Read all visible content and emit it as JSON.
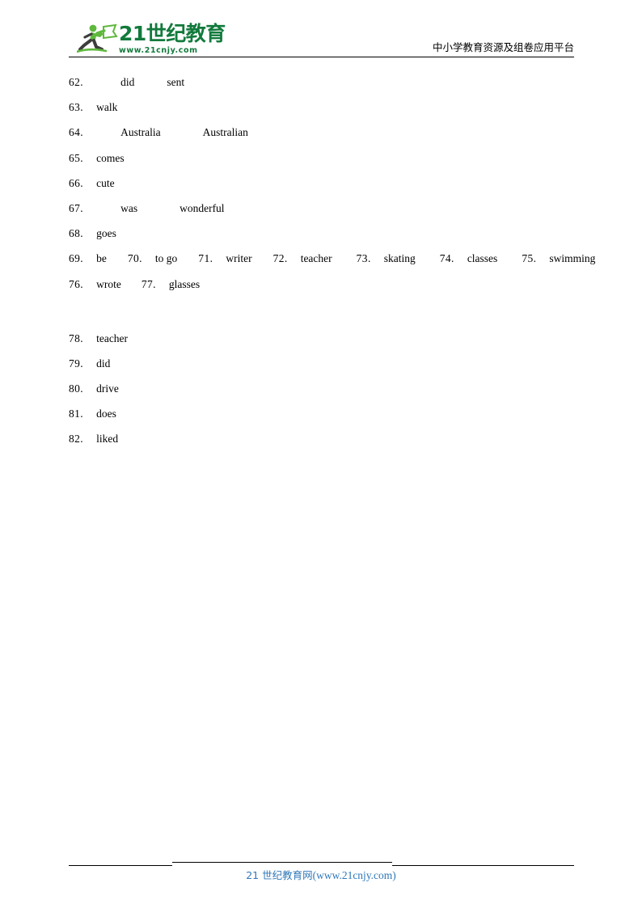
{
  "header": {
    "logo": {
      "icon": "running-person-with-flag-icon",
      "main_text": "21世纪教育",
      "url_text": "www.21cnjy.com",
      "color": "#127a3c",
      "runner_color": "#5fb83d"
    },
    "slogan": "中小学教育资源及组卷应用平台"
  },
  "answers": {
    "group_one": [
      {
        "num": "62.",
        "indent": true,
        "parts": [
          "did",
          "sent"
        ]
      },
      {
        "num": "63.",
        "indent": false,
        "parts": [
          "walk"
        ]
      },
      {
        "num": "64.",
        "indent": true,
        "parts": [
          "Australia",
          "Australian"
        ]
      },
      {
        "num": "65.",
        "indent": false,
        "parts": [
          "comes"
        ]
      },
      {
        "num": "66.",
        "indent": false,
        "parts": [
          "cute"
        ]
      },
      {
        "num": "67.",
        "indent": true,
        "parts": [
          "was",
          "wonderful"
        ]
      },
      {
        "num": "68.",
        "indent": false,
        "parts": [
          "goes"
        ]
      }
    ],
    "inline_row_1": [
      {
        "num": "69.",
        "text": "be"
      },
      {
        "num": "70.",
        "text": "to go"
      },
      {
        "num": "71.",
        "text": "writer"
      },
      {
        "num": "72.",
        "text": "teacher"
      },
      {
        "num": "73.",
        "text": "skating"
      },
      {
        "num": "74.",
        "text": "classes"
      },
      {
        "num": "75.",
        "text": "swimming"
      }
    ],
    "inline_row_2": [
      {
        "num": "76.",
        "text": "wrote"
      },
      {
        "num": "77.",
        "text": "glasses"
      }
    ],
    "group_two": [
      {
        "num": "78.",
        "text": "teacher"
      },
      {
        "num": "79.",
        "text": "did"
      },
      {
        "num": "80.",
        "text": "drive"
      },
      {
        "num": "81.",
        "text": "does"
      },
      {
        "num": "82.",
        "text": "liked"
      }
    ]
  },
  "footer": {
    "link_cn": "21 世纪教育网",
    "link_url": "(www.21cnjy.com)",
    "color": "#2f77b8"
  }
}
